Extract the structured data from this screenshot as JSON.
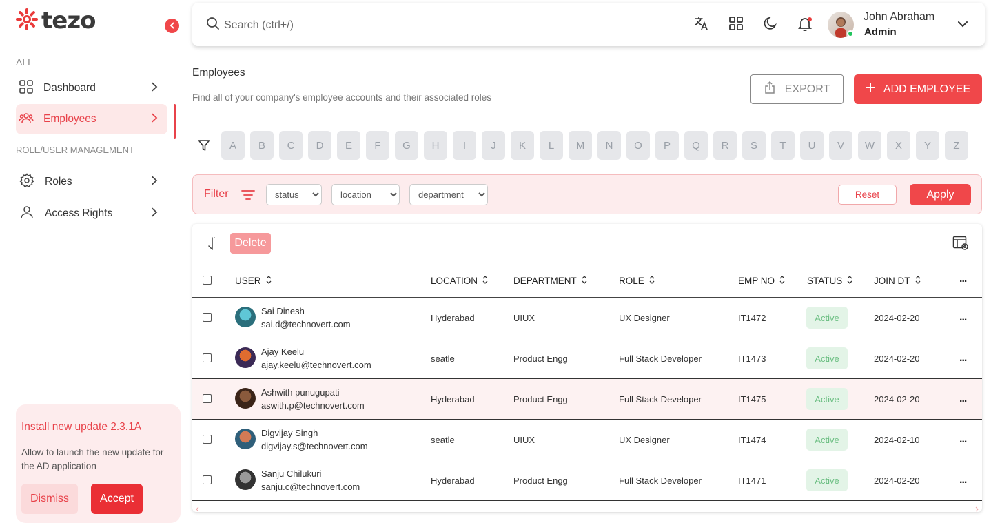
{
  "app": {
    "logo_text": "tezo"
  },
  "sidebar": {
    "section_all": "ALL",
    "section_role": "ROLE/USER MANAGEMENT",
    "items": [
      {
        "label": "Dashboard",
        "icon": "grid-icon"
      },
      {
        "label": "Employees",
        "icon": "users-icon",
        "active": true
      },
      {
        "label": "Roles",
        "icon": "gear-icon"
      },
      {
        "label": "Access Rights",
        "icon": "user-icon"
      }
    ],
    "update": {
      "title": "Install new update 2.3.1A",
      "description": "Allow to launch the new update for the AD application",
      "dismiss_label": "Dismiss",
      "accept_label": "Accept"
    }
  },
  "topbar": {
    "search_placeholder": "Search (ctrl+/)",
    "user": {
      "name": "John Abraham",
      "role": "Admin"
    }
  },
  "page": {
    "title": "Employees",
    "subtitle": "Find all of your company's employee accounts and their associated roles",
    "export_label": "EXPORT",
    "add_label": "ADD EMPLOYEE"
  },
  "alphabet": [
    "A",
    "B",
    "C",
    "D",
    "E",
    "F",
    "G",
    "H",
    "I",
    "J",
    "K",
    "L",
    "M",
    "N",
    "O",
    "P",
    "Q",
    "R",
    "S",
    "T",
    "U",
    "V",
    "W",
    "X",
    "Y",
    "Z"
  ],
  "filter": {
    "label": "Filter",
    "status": "status",
    "location": "location",
    "department": "department",
    "reset_label": "Reset",
    "apply_label": "Apply"
  },
  "table": {
    "delete_label": "Delete",
    "columns": [
      "USER",
      "LOCATION",
      "DEPARTMENT",
      "ROLE",
      "EMP NO",
      "STATUS",
      "JOIN DT"
    ],
    "more_label": "...",
    "rows": [
      {
        "name": "Sai Dinesh",
        "email": "sai.d@technovert.com",
        "location": "Hyderabad",
        "department": "UIUX",
        "role": "UX Designer",
        "emp_no": "IT1472",
        "status": "Active",
        "join_dt": "2024-02-20"
      },
      {
        "name": "Ajay Keelu",
        "email": "ajay.keelu@technovert.com",
        "location": "seatle",
        "department": "Product Engg",
        "role": "Full Stack Developer",
        "emp_no": "IT1473",
        "status": "Active",
        "join_dt": "2024-02-20"
      },
      {
        "name": "Ashwith punugupati",
        "email": "aswith.p@technovert.com",
        "location": "Hyderabad",
        "department": "Product Engg",
        "role": "Full Stack Developer",
        "emp_no": "IT1475",
        "status": "Active",
        "join_dt": "2024-02-20"
      },
      {
        "name": "Digvijay Singh",
        "email": "digvijay.s@technovert.com",
        "location": "seatle",
        "department": "UIUX",
        "role": "UX Designer",
        "emp_no": "IT1474",
        "status": "Active",
        "join_dt": "2024-02-10"
      },
      {
        "name": "Sanju Chilukuri",
        "email": "sanju.c@technovert.com",
        "location": "Hyderabad",
        "department": "Product Engg",
        "role": "Full Stack Developer",
        "emp_no": "IT1471",
        "status": "Active",
        "join_dt": "2024-02-20"
      }
    ]
  },
  "colors": {
    "accent": "#f0474a",
    "accent_light": "#fdeced",
    "status_active_bg": "#e3f4e7",
    "status_active_text": "#6cbf83"
  }
}
